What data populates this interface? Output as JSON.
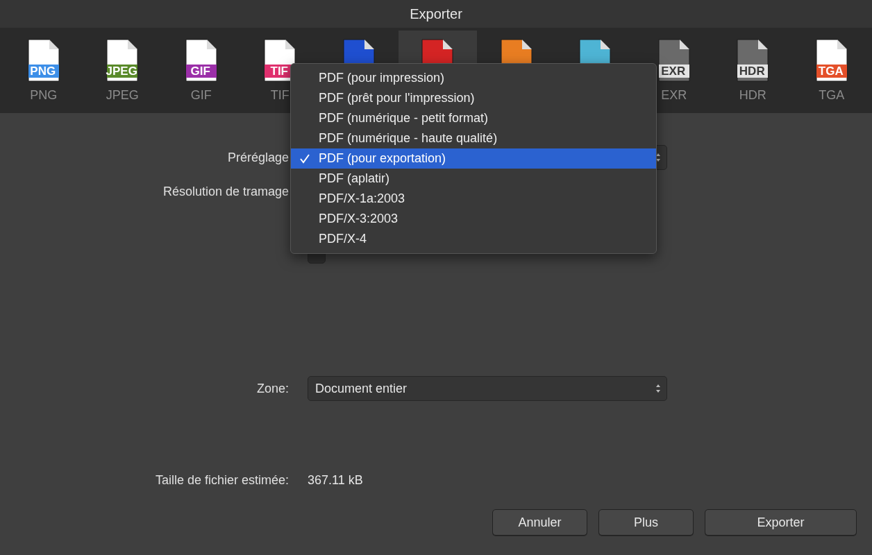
{
  "window": {
    "title": "Exporter"
  },
  "formats": [
    {
      "kind": "band",
      "color": "#3d8fe8",
      "badge": "PNG",
      "label": "PNG",
      "selected": false
    },
    {
      "kind": "band",
      "color": "#5a8a2a",
      "badge": "JPEG",
      "label": "JPEG",
      "selected": false
    },
    {
      "kind": "band",
      "color": "#9b2fa8",
      "badge": "GIF",
      "label": "GIF",
      "selected": false
    },
    {
      "kind": "band",
      "color": "#e0306e",
      "badge": "TIF",
      "label": "TIF",
      "selected": false
    },
    {
      "kind": "solid",
      "color": "#1f4fd0",
      "selected": false
    },
    {
      "kind": "solid",
      "color": "#d42424",
      "selected": true
    },
    {
      "kind": "solid",
      "color": "#e87d22",
      "selected": false
    },
    {
      "kind": "solid",
      "color": "#4eb4d4",
      "selected": false
    },
    {
      "kind": "gray",
      "color": "#6a6a6a",
      "badge": "EXR",
      "label": "EXR",
      "selected": false
    },
    {
      "kind": "gray",
      "color": "#6a6a6a",
      "badge": "HDR",
      "label": "HDR",
      "selected": false
    },
    {
      "kind": "band",
      "color": "#e4502a",
      "badge": "TGA",
      "label": "TGA",
      "selected": false
    }
  ],
  "preset": {
    "label": "Préréglage",
    "menu": [
      {
        "label": "PDF (pour impression)",
        "selected": false
      },
      {
        "label": "PDF (prêt pour l'impression)",
        "selected": false
      },
      {
        "label": "PDF (numérique - petit format)",
        "selected": false
      },
      {
        "label": "PDF (numérique - haute qualité)",
        "selected": false
      },
      {
        "label": "PDF (pour exportation)",
        "selected": true
      },
      {
        "label": "PDF (aplatir)",
        "selected": false
      },
      {
        "label": "PDF/X-1a:2003",
        "selected": false
      },
      {
        "label": "PDF/X-3:2003",
        "selected": false
      },
      {
        "label": "PDF/X-4",
        "selected": false
      }
    ]
  },
  "rasterize": {
    "label": "Résolution de tramage"
  },
  "preview_checkbox": {
    "checked": false
  },
  "zone": {
    "label": "Zone:",
    "value": "Document entier"
  },
  "file_size": {
    "label": "Taille de fichier estimée:",
    "value": "367.11 kB"
  },
  "buttons": [
    "Annuler",
    "Plus",
    "Exporter"
  ]
}
